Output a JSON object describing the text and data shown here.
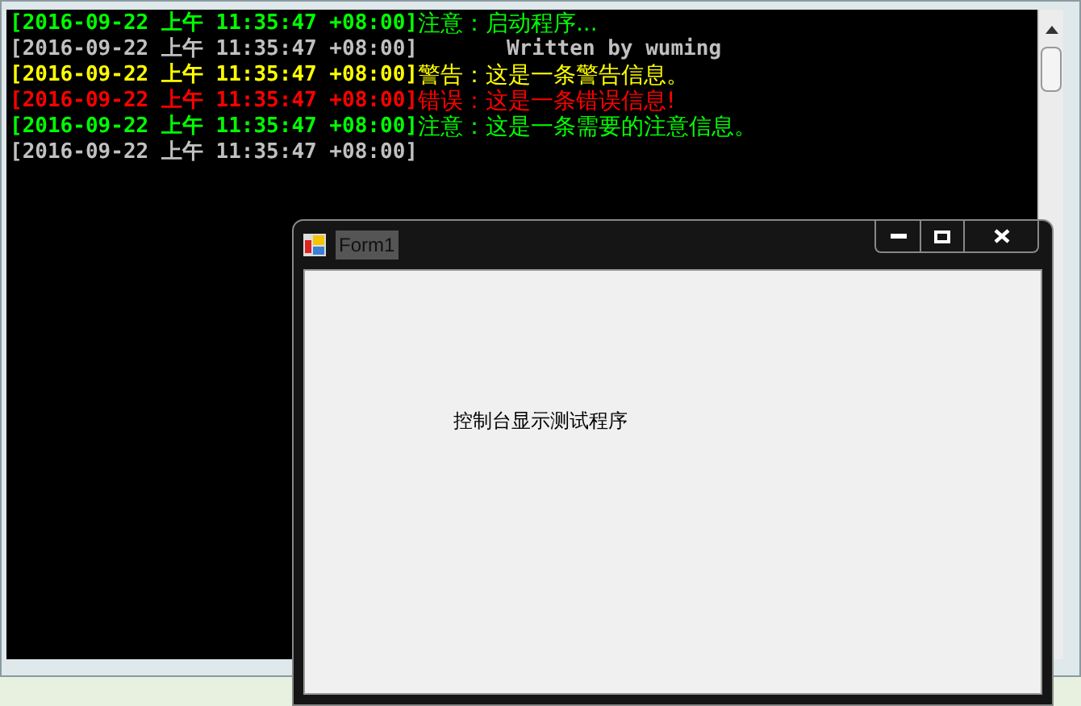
{
  "console": {
    "lines": [
      {
        "kind": "log",
        "timestamp": "[2016-09-22 上午 11:35:47 +08:00]",
        "message": "注意：启动程序...",
        "color": "#00ff00"
      },
      {
        "kind": "credit",
        "timestamp": "[2016-09-22 上午 11:35:47 +08:00]",
        "message": "Written by wuming",
        "color": "#c0c0c0"
      },
      {
        "kind": "log",
        "timestamp": "[2016-09-22 上午 11:35:47 +08:00]",
        "message": "警告：这是一条警告信息。",
        "color": "#ffff00"
      },
      {
        "kind": "log",
        "timestamp": "[2016-09-22 上午 11:35:47 +08:00]",
        "message": "错误：这是一条错误信息!",
        "color": "#ff0000"
      },
      {
        "kind": "log",
        "timestamp": "[2016-09-22 上午 11:35:47 +08:00]",
        "message": "注意：这是一条需要的注意信息。",
        "color": "#00ff00"
      },
      {
        "kind": "log",
        "timestamp": "[2016-09-22 上午 11:35:47 +08:00]",
        "color": "#c0c0c0"
      }
    ]
  },
  "form": {
    "title": "Form1",
    "label": "控制台显示测试程序"
  }
}
